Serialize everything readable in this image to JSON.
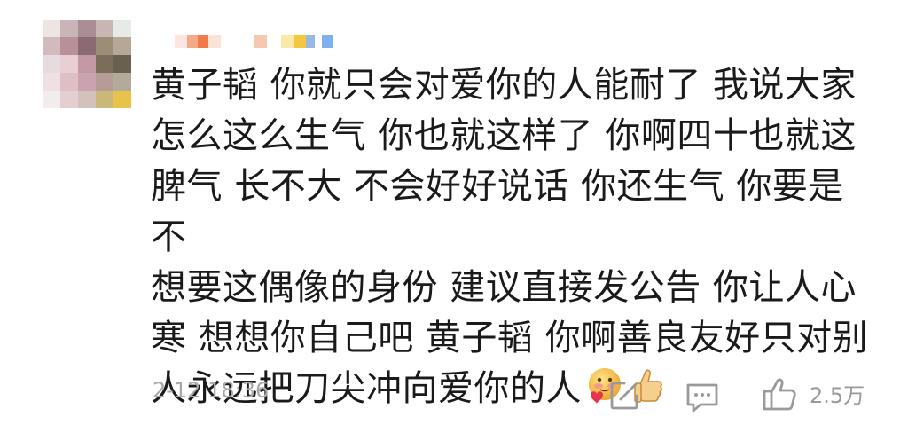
{
  "comment": {
    "lines": [
      "黄子韬 你就只会对爱你的人能耐了 我说大家",
      "怎么这么生气 你也就这样了 你啊四十也就这",
      "脾气 长不大 不会好好说话 你还生气 你要是不",
      "想要这偶像的身份 建议直接发公告 你让人心",
      "寒 想想你自己吧 黄子韬 你啊善良友好只对别",
      "人永远把刀尖冲向爱你的人"
    ]
  },
  "meta": {
    "timestamp": "2-12 18:36",
    "like_count": "2.5万"
  },
  "icons": {
    "share": "share-icon",
    "comment": "comment-icon",
    "like": "thumbs-up-icon",
    "emoji1": "blushing-heart-emoji-icon",
    "emoji2": "thumbs-up-emoji-icon"
  },
  "colors": {
    "text": "#1a1a1a",
    "meta": "#a8a8a8"
  }
}
